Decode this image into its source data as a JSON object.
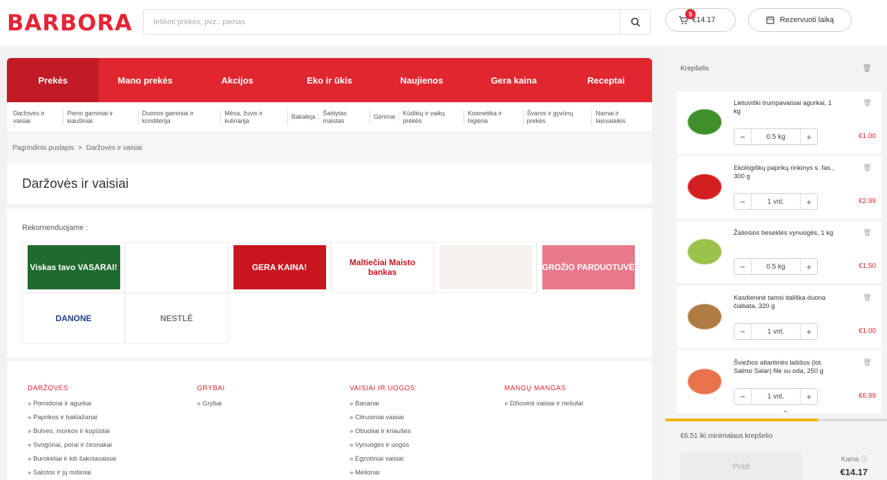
{
  "header": {
    "logo": "BARBORA",
    "search_placeholder": "Ieškoti prekės, pvz.: pienas",
    "cart_badge": "5",
    "cart_total": "€14.17",
    "reserve_label": "Rezervuoti laiką"
  },
  "nav": {
    "tabs": [
      "Prekės",
      "Mano prekės",
      "Akcijos",
      "Eko ir ūkis",
      "Naujienos",
      "Gera kaina",
      "Receptai"
    ],
    "subcats": [
      "Daržovės ir vaisiai",
      "Pieno gaminiai ir kiaušiniai",
      "Duonos gaminiai ir konditerija",
      "Mėsa, žuvis ir kulinarija",
      "Bakalėja",
      "Šaldytas maistas",
      "Gėrimai",
      "Kūdikių ir vaikų prekės",
      "Kosmetika ir higiena",
      "Švaros ir gyvūnų prekės",
      "Namai ir laisvalaikis"
    ]
  },
  "breadcrumb": {
    "home": "Pagrindinis puslapis",
    "sep": ">",
    "current": "Daržovės ir vaisiai"
  },
  "page_title": "Daržovės ir vaisiai",
  "recommend": {
    "label": "Rekomenduojame :",
    "brands": [
      {
        "text": "Viskas tavo VASARAI!",
        "bg": "#1f6b2e",
        "fg": "#ffffff"
      },
      {
        "text": "",
        "bg": "#ffffff",
        "fg": "#333333"
      },
      {
        "text": "GERA KAINA!",
        "bg": "#c9151e",
        "fg": "#ffffff"
      },
      {
        "text": "Maltiečiai Maisto bankas",
        "bg": "#ffffff",
        "fg": "#c9151e"
      },
      {
        "text": "",
        "bg": "#f5f1ec",
        "fg": "#333333"
      },
      {
        "text": "GROŽIO PARDUOTUVĖ",
        "bg": "#e8798a",
        "fg": "#ffffff"
      },
      {
        "text": "DANONE",
        "bg": "#ffffff",
        "fg": "#1d3f91"
      },
      {
        "text": "NESTLÉ",
        "bg": "#ffffff",
        "fg": "#777777"
      }
    ]
  },
  "categories": [
    {
      "title": "DARŽOVĖS",
      "items": [
        "Pomidorai ir agurkai",
        "Paprikos ir baklažanai",
        "Bulvės, morkos ir kopūstai",
        "Svogūnai, porai ir česnakai",
        "Burokėliai ir kiti šakniavaisiai",
        "Salotos ir jų mišiniai"
      ]
    },
    {
      "title": "GRYBAI",
      "items": [
        "Grybai"
      ]
    },
    {
      "title": "VAISIAI IR UOGOS",
      "items": [
        "Bananai",
        "Citrusiniai vaisiai",
        "Obuoliai ir kriaušės",
        "Vynuogės ir uogos",
        "Egzotiniai vaisiai",
        "Melionai"
      ]
    },
    {
      "title": "MANGŲ MANGAS",
      "items": [
        "Džiovinti vaisiai ir riešutai"
      ]
    }
  ],
  "cart": {
    "title": "Krepšelis",
    "items": [
      {
        "name": "Lietuviški trumpavaisiai agurkai, 1 kg",
        "qty": "0.5 kg",
        "price": "€1.00",
        "color": "#3f8f2a"
      },
      {
        "name": "Ekologiškų paprikų rinkinys s. fas., 300 g",
        "qty": "1 vnt.",
        "price": "€2.99",
        "color": "#d42020"
      },
      {
        "name": "Žaliosios beseklės vynuogės, 1 kg",
        "qty": "0.5 kg",
        "price": "€1.50",
        "color": "#9bc24a"
      },
      {
        "name": "Kasdieninė tamsi itališka duona čiabata, 320 g",
        "qty": "1 vnt.",
        "price": "€1.00",
        "color": "#b07a43"
      },
      {
        "name": "Šviežios atlantinės lašišos (lot. Salmo Salar) filė su oda, 250 g",
        "qty": "1 vnt.",
        "price": "€6.99",
        "color": "#e8724a"
      }
    ],
    "min_text": "€6.51 iki minimalaus krepšelio",
    "progress": 0.69,
    "checkout_label": "Pirkti",
    "price_label": "Kaina ⓘ",
    "price_value": "€14.17"
  },
  "colors": {
    "brand_red": "#e0262f",
    "progress": "#f2b600"
  }
}
